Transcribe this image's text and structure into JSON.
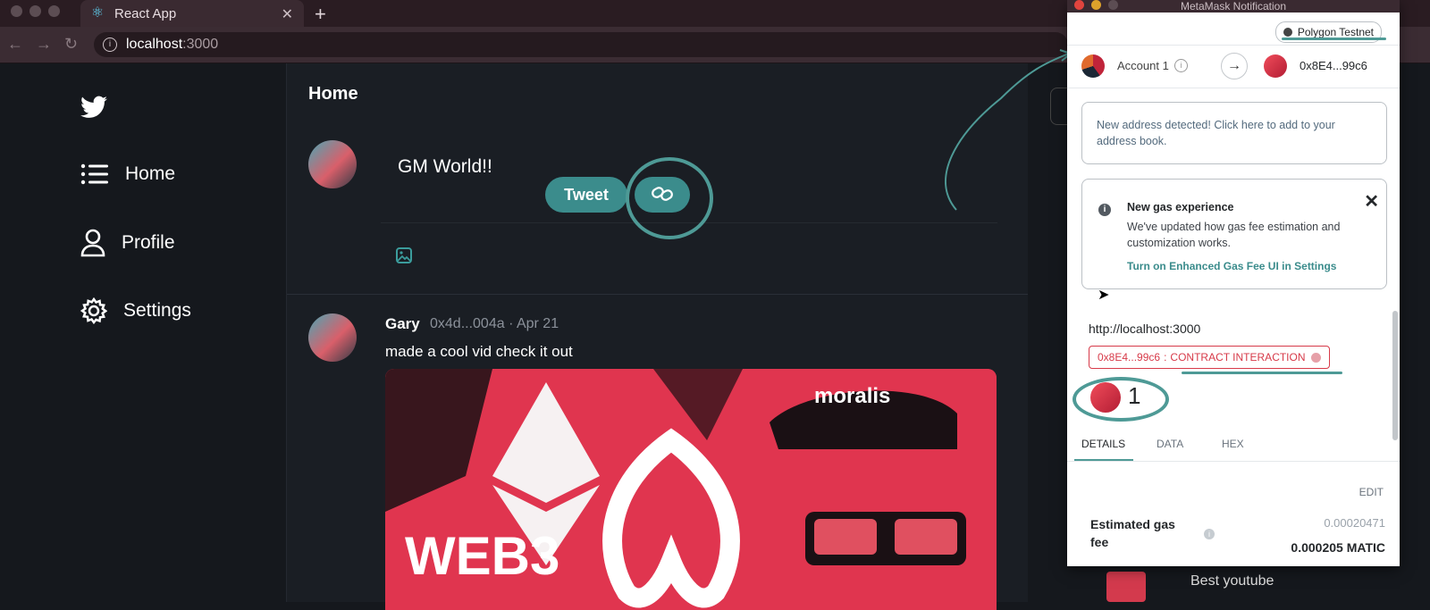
{
  "browser": {
    "tab_title": "React App",
    "url_host": "localhost",
    "url_port": ":3000"
  },
  "sidebar": {
    "items": [
      {
        "label": "Home",
        "icon": "list-icon"
      },
      {
        "label": "Profile",
        "icon": "user-icon"
      },
      {
        "label": "Settings",
        "icon": "gear-icon"
      }
    ]
  },
  "feed": {
    "title": "Home",
    "composer": {
      "text": "GM World!!",
      "tweet_label": "Tweet"
    },
    "post": {
      "author": "Gary",
      "meta": "0x4d...004a · Apr 21",
      "text": "made a cool vid check it out",
      "media_text_1": "moralis",
      "media_text_2": "WEB3"
    }
  },
  "right": {
    "suggest_text": "Best youtube"
  },
  "metamask": {
    "window_title": "MetaMask Notification",
    "network": "Polygon Testnet",
    "from_account": "Account 1",
    "to_address": "0x8E4...99c6",
    "new_address_notice": "New address detected! Click here to add to your address book.",
    "gas_notice": {
      "heading": "New gas experience",
      "body": "We've updated how gas fee estimation and customization works.",
      "link": "Turn on Enhanced Gas Fee UI in Settings",
      "close": "✕"
    },
    "origin": "http://localhost:3000",
    "contract_address": "0x8E4...99c6",
    "contract_label": "CONTRACT INTERACTION",
    "amount": "1",
    "tabs": [
      "DETAILS",
      "DATA",
      "HEX"
    ],
    "edit_label": "EDIT",
    "gas_label": "Estimated gas fee",
    "gas_fiat": "0.00020471",
    "gas_value": "0.000205 MATIC"
  },
  "colors": {
    "accent": "#3b8c8c",
    "annotation": "#4e9a96",
    "contract_red": "#d73a49"
  }
}
